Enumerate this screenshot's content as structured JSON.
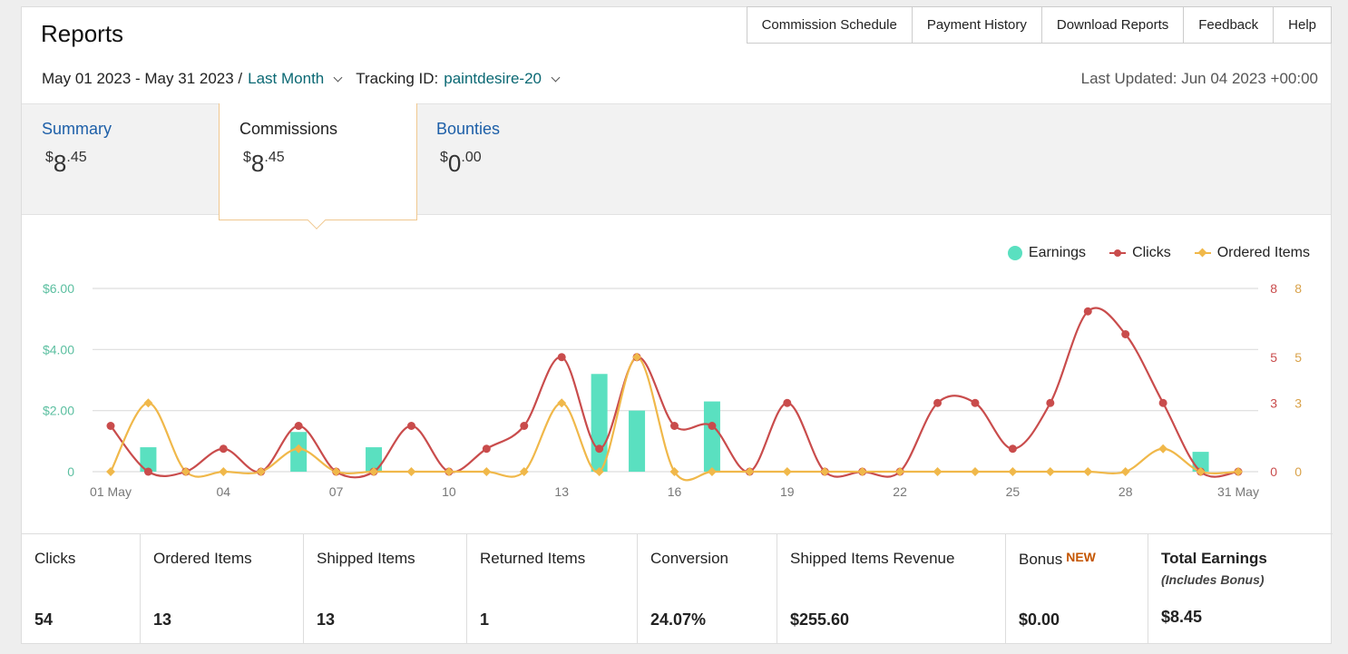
{
  "header": {
    "title": "Reports",
    "nav": [
      "Commission Schedule",
      "Payment History",
      "Download Reports",
      "Feedback",
      "Help"
    ]
  },
  "filters": {
    "date_range": "May 01 2023 - May 31 2023 /",
    "period": "Last Month",
    "tracking_label": "Tracking ID:",
    "tracking_id": "paintdesire-20",
    "last_updated": "Last Updated: Jun 04 2023 +00:00"
  },
  "tabs": {
    "summary": {
      "label": "Summary",
      "currency": "$",
      "whole": "8",
      "cents": ".45"
    },
    "commissions": {
      "label": "Commissions",
      "currency": "$",
      "whole": "8",
      "cents": ".45"
    },
    "bounties": {
      "label": "Bounties",
      "currency": "$",
      "whole": "0",
      "cents": ".00"
    }
  },
  "legend": {
    "earnings": "Earnings",
    "clicks": "Clicks",
    "ordered_items": "Ordered Items"
  },
  "chart_data": {
    "type": "bar",
    "x": [
      "01 May",
      "02",
      "03",
      "04",
      "05",
      "06",
      "07",
      "08",
      "09",
      "10",
      "11",
      "12",
      "13",
      "14",
      "15",
      "16",
      "17",
      "18",
      "19",
      "20",
      "21",
      "22",
      "23",
      "24",
      "25",
      "26",
      "27",
      "28",
      "29",
      "30",
      "31 May"
    ],
    "x_tick_labels": [
      "01 May",
      "04",
      "07",
      "10",
      "13",
      "16",
      "19",
      "22",
      "25",
      "28",
      "31 May"
    ],
    "x_tick_index": [
      0,
      3,
      6,
      9,
      12,
      15,
      18,
      21,
      24,
      27,
      30
    ],
    "series": [
      {
        "name": "Earnings",
        "type": "bar",
        "axis": "left",
        "color": "#5ae0c0",
        "values": [
          0,
          0.8,
          0,
          0,
          0,
          1.3,
          0,
          0.8,
          0,
          0,
          0,
          0,
          0,
          3.2,
          2.0,
          0,
          2.3,
          0,
          0,
          0,
          0,
          0,
          0,
          0,
          0,
          0,
          0,
          0,
          0,
          0.65,
          0
        ]
      },
      {
        "name": "Clicks",
        "type": "line",
        "axis": "right",
        "color": "#c94c4c",
        "values": [
          2,
          0,
          0,
          1,
          0,
          2,
          0,
          0,
          2,
          0,
          1,
          2,
          5,
          1,
          5,
          2,
          2,
          0,
          3,
          0,
          0,
          0,
          3,
          3,
          1,
          3,
          7,
          6,
          3,
          0,
          0
        ]
      },
      {
        "name": "Ordered Items",
        "type": "line",
        "axis": "right",
        "color": "#f0b84a",
        "values": [
          0,
          3,
          0,
          0,
          0,
          1,
          0,
          0,
          0,
          0,
          0,
          0,
          3,
          0,
          5,
          0,
          0,
          0,
          0,
          0,
          0,
          0,
          0,
          0,
          0,
          0,
          0,
          0,
          1,
          0,
          0
        ]
      }
    ],
    "left_axis": {
      "ticks": [
        "0",
        "$2.00",
        "$4.00",
        "$6.00"
      ],
      "values": [
        0,
        2,
        4,
        6
      ],
      "ylim": [
        0,
        6
      ],
      "color": "#5bbfa0"
    },
    "right_axis_1": {
      "ticks": [
        "0",
        "3",
        "5",
        "8"
      ],
      "values": [
        0,
        3,
        5,
        8
      ],
      "color": "#c94c4c"
    },
    "right_axis_2": {
      "ticks": [
        "0",
        "3",
        "5",
        "8"
      ],
      "values": [
        0,
        3,
        5,
        8
      ],
      "color": "#d9a24a"
    },
    "right_ylim": [
      0,
      8
    ],
    "grid": true,
    "legend_position": "top-right"
  },
  "stats": [
    {
      "label": "Clicks",
      "value": "54"
    },
    {
      "label": "Ordered Items",
      "value": "13"
    },
    {
      "label": "Shipped Items",
      "value": "13"
    },
    {
      "label": "Returned Items",
      "value": "1"
    },
    {
      "label": "Conversion",
      "value": "24.07%"
    },
    {
      "label": "Shipped Items Revenue",
      "value": "$255.60"
    },
    {
      "label": "Bonus",
      "badge": "NEW",
      "value": "$0.00"
    },
    {
      "label": "Total Earnings",
      "sub": "(Includes Bonus)",
      "value": "$8.45"
    }
  ]
}
